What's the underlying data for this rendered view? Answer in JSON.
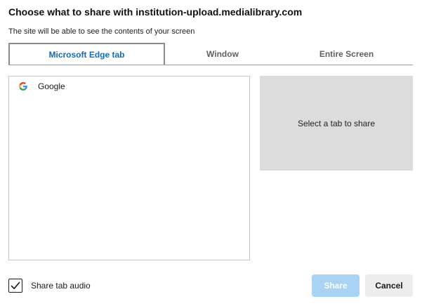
{
  "dialog": {
    "title": "Choose what to share with institution-upload.medialibrary.com",
    "subtitle": "The site will be able to see the contents of your screen"
  },
  "tabs": [
    {
      "label": "Microsoft Edge tab",
      "active": true
    },
    {
      "label": "Window",
      "active": false
    },
    {
      "label": "Entire Screen",
      "active": false
    }
  ],
  "tab_list": {
    "items": [
      {
        "label": "Google",
        "icon": "google-g-icon"
      }
    ]
  },
  "preview": {
    "placeholder": "Select a tab to share"
  },
  "footer": {
    "audio_label": "Share tab audio",
    "audio_checked": true,
    "share_label": "Share",
    "share_enabled": false,
    "cancel_label": "Cancel"
  },
  "colors": {
    "accent": "#0f6cbd",
    "share_disabled_bg": "#a9d3f5",
    "preview_bg": "#dcdcdc",
    "cancel_bg": "#ededed"
  }
}
